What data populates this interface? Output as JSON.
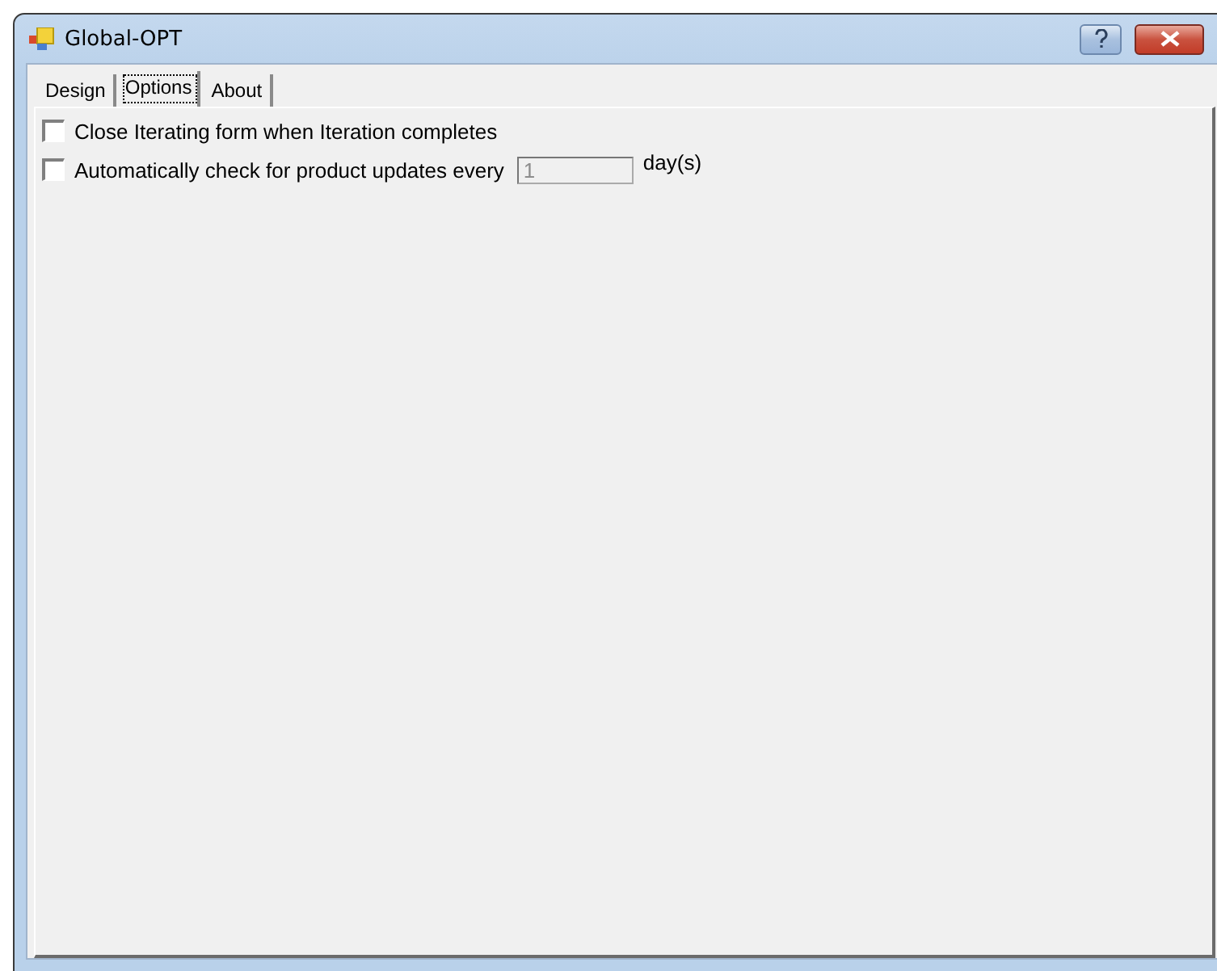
{
  "window": {
    "title": "Global-OPT"
  },
  "tabs": [
    {
      "label": "Design",
      "selected": false
    },
    {
      "label": "Options",
      "selected": true
    },
    {
      "label": "About",
      "selected": false
    }
  ],
  "options": [
    {
      "kind": "checkbox",
      "label": "Close Iterating form when Iteration completes",
      "checked": false
    },
    {
      "kind": "checkbox-field",
      "label": "Automatically check for product updates every",
      "checked": false,
      "value": "1",
      "disabled": true,
      "unit": "day(s)"
    }
  ]
}
